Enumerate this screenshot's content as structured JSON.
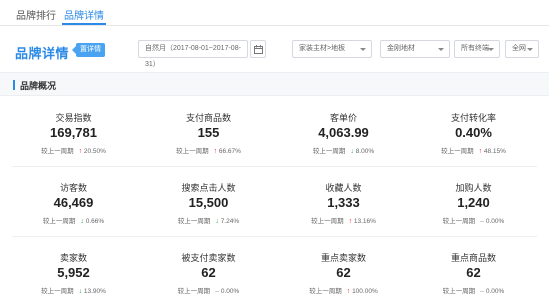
{
  "nav": {
    "tabs": [
      {
        "label": "品牌排行",
        "active": false
      },
      {
        "label": "品牌详情",
        "active": true
      }
    ]
  },
  "header": {
    "title": "品牌详情",
    "badge": "置详情",
    "filters": {
      "date": "自然月（2017-08-01~2017-08-31）",
      "category": "家装主材>地板",
      "brand": "金刚地材",
      "channel": "所有终端",
      "network": "全网"
    }
  },
  "section": {
    "title": "品牌概况"
  },
  "metrics": [
    {
      "label": "交易指数",
      "value": "169,781",
      "compare_label": "较上一周期",
      "trend": "up",
      "change": "20.50%"
    },
    {
      "label": "支付商品数",
      "value": "155",
      "compare_label": "较上一周期",
      "trend": "up",
      "change": "66.67%"
    },
    {
      "label": "客单价",
      "value": "4,063.99",
      "compare_label": "较上一周期",
      "trend": "down",
      "change": "8.00%"
    },
    {
      "label": "支付转化率",
      "value": "0.40%",
      "compare_label": "较上一周期",
      "trend": "up",
      "change": "48.15%"
    },
    {
      "label": "访客数",
      "value": "46,469",
      "compare_label": "较上一周期",
      "trend": "down",
      "change": "0.66%"
    },
    {
      "label": "搜索点击人数",
      "value": "15,500",
      "compare_label": "较上一周期",
      "trend": "down",
      "change": "7.24%"
    },
    {
      "label": "收藏人数",
      "value": "1,333",
      "compare_label": "较上一周期",
      "trend": "up",
      "change": "13.16%"
    },
    {
      "label": "加购人数",
      "value": "1,240",
      "compare_label": "较上一周期",
      "trend": "flat",
      "change": "0.00%"
    },
    {
      "label": "卖家数",
      "value": "5,952",
      "compare_label": "较上一周期",
      "trend": "down",
      "change": "13.90%"
    },
    {
      "label": "被支付卖家数",
      "value": "62",
      "compare_label": "较上一周期",
      "trend": "flat",
      "change": "0.00%"
    },
    {
      "label": "重点卖家数",
      "value": "62",
      "compare_label": "较上一周期",
      "trend": "up",
      "change": "100.00%"
    },
    {
      "label": "重点商品数",
      "value": "62",
      "compare_label": "较上一周期",
      "trend": "flat",
      "change": "0.00%"
    }
  ],
  "colors": {
    "accent": "#2b8ae8",
    "up": "#f5222d",
    "down": "#2aa84a",
    "flat": "#999999"
  },
  "icons": {
    "calendar": "calendar-icon",
    "up": "arrow-up-icon",
    "down": "arrow-down-icon",
    "flat": "dash-icon"
  }
}
